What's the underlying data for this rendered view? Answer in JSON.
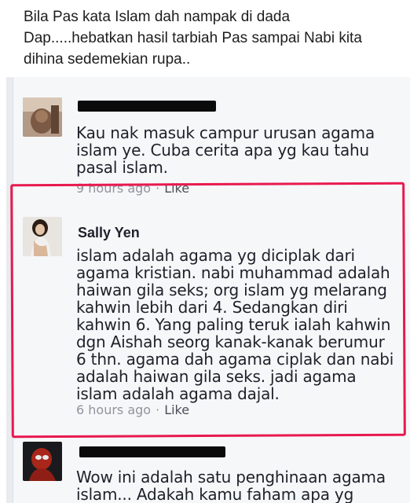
{
  "caption": {
    "line1": "Bila Pas kata Islam dah nampak di dada",
    "line2": "Dap.....hebatkan hasil tarbiah Pas sampai Nabi kita",
    "line3": "dihina sedemekian rupa.."
  },
  "comments": [
    {
      "name": "",
      "name_redacted": true,
      "text_lines": [
        "Kau nak masuk campur urusan agama",
        "islam ye. Cuba cerita apa yg kau tahu",
        "pasal islam."
      ],
      "time": "9 hours ago",
      "like_label": "Like",
      "avatar_color": "#8a6a52"
    },
    {
      "name": "Sally Yen",
      "name_redacted": false,
      "text_lines": [
        "islam adalah agama yg diciplak dari",
        "agama kristian. nabi muhammad adalah",
        "haiwan gila seks; org islam yg melarang",
        "kahwin lebih dari 4. Sedangkan diri",
        "kahwin 6. Yang paling teruk ialah kahwin",
        "dgn Aishah seorg kanak-kanak berumur",
        "6 thn. agama dah agama ciplak dan nabi",
        "adalah haiwan gila seks. jadi agama",
        "islam adalah agama dajal."
      ],
      "time": "6 hours ago",
      "like_label": "Like",
      "avatar_color": "#c9b7a8"
    },
    {
      "name": "",
      "name_redacted": true,
      "text_lines": [
        "Wow ini adalah satu penghinaan agama",
        "islam... Adakah kamu faham apa yg"
      ],
      "avatar_color": "#7a2418"
    }
  ],
  "colors": {
    "highlight": "#e8194f",
    "meta": "#90949c",
    "background": "#f6f7f9"
  },
  "separator": "·"
}
